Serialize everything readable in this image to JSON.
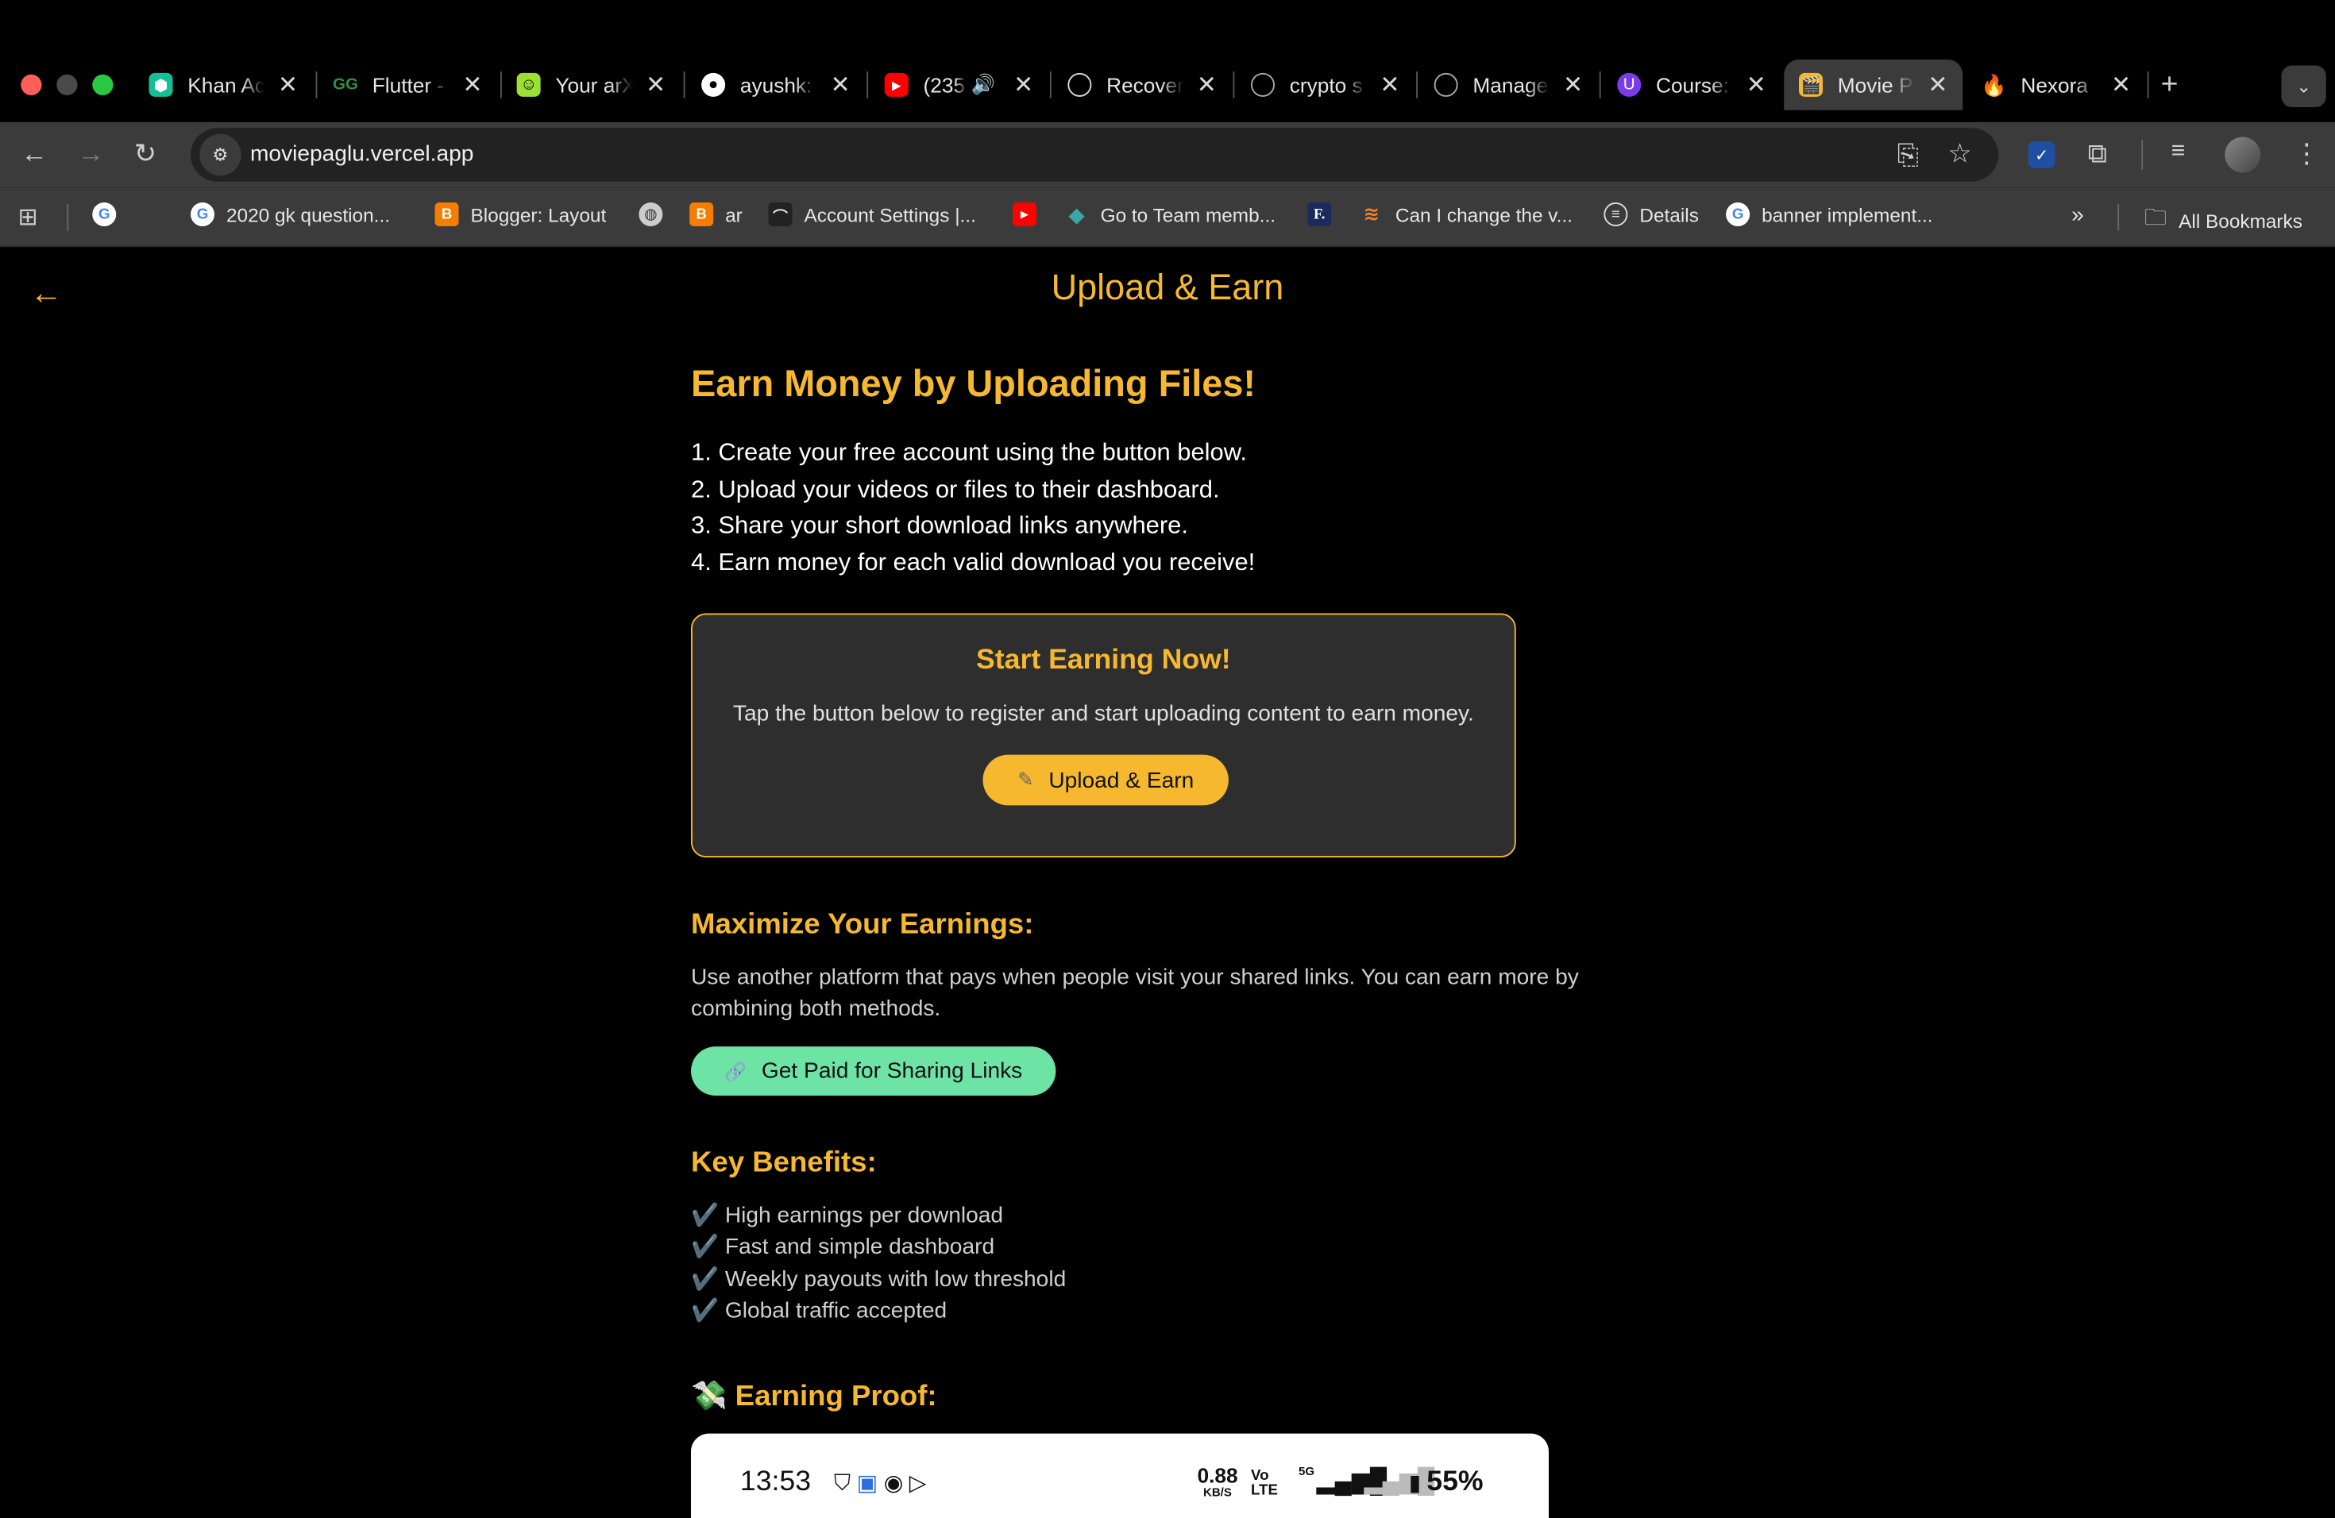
{
  "browser": {
    "tabs": [
      {
        "title": "Khan Ac",
        "icon": "khan-academy-icon",
        "color": "#14bf96"
      },
      {
        "title": "Flutter -",
        "icon": "geeksforgeeks-icon",
        "color": "#2f8d46"
      },
      {
        "title": "Your arX",
        "icon": "smiley-icon",
        "color": "#9be032"
      },
      {
        "title": "ayushk:",
        "icon": "github-icon",
        "color": "#ffffff"
      },
      {
        "title": "(235",
        "icon": "youtube-icon",
        "color": "#ff0000"
      },
      {
        "title": "Recover",
        "icon": "openai-icon",
        "color": "#e0e0e0"
      },
      {
        "title": "crypto s",
        "icon": "openai-icon",
        "color": "#e0e0e0"
      },
      {
        "title": "Manage",
        "icon": "openai-icon",
        "color": "#e0e0e0"
      },
      {
        "title": "Course:",
        "icon": "course-icon",
        "color": "#7c3aed"
      },
      {
        "title": "Movie P",
        "icon": "clapperboard-icon",
        "color": "#f5b82e"
      },
      {
        "title": "Nexora",
        "icon": "fire-icon",
        "color": "#ff6b2c"
      }
    ],
    "url": "moviepaglu.vercel.app",
    "bookmarks": [
      {
        "label": "",
        "icon": "google-icon"
      },
      {
        "label": "2020 gk question...",
        "icon": "google-icon"
      },
      {
        "label": "Blogger: Layout",
        "icon": "blogger-icon"
      },
      {
        "label": "",
        "icon": "globe-icon"
      },
      {
        "label": "ar",
        "icon": "blogger-icon"
      },
      {
        "label": "Account Settings |...",
        "icon": "account-icon"
      },
      {
        "label": "",
        "icon": "youtube-icon"
      },
      {
        "label": "Go to Team memb...",
        "icon": "diamond-icon"
      },
      {
        "label": "",
        "icon": "f-logo-icon"
      },
      {
        "label": "Can I change the v...",
        "icon": "stackoverflow-icon"
      },
      {
        "label": "Details",
        "icon": "details-icon"
      },
      {
        "label": "banner implement...",
        "icon": "google-icon"
      }
    ],
    "all_bookmarks": "All Bookmarks",
    "more_bookmarks": "»"
  },
  "page": {
    "title": "Upload & Earn",
    "heading": "Earn Money by Uploading Files!",
    "steps": [
      "1. Create your free account using the button below.",
      "2. Upload your videos or files to their dashboard.",
      "3. Share your short download links anywhere.",
      "4. Earn money for each valid download you receive!"
    ],
    "card": {
      "title": "Start Earning Now!",
      "text": "Tap the button below to register and start uploading content to earn money.",
      "button": "Upload & Earn",
      "button_icon": "pencil-icon"
    },
    "maximize": {
      "heading": "Maximize Your Earnings:",
      "text": "Use another platform that pays when people visit your shared links. You can earn more by combining both methods.",
      "button": "Get Paid for Sharing Links",
      "button_icon": "link-icon"
    },
    "benefits": {
      "heading": "Key Benefits:",
      "items": [
        "✔️ High earnings per download",
        "✔️ Fast and simple dashboard",
        "✔️ Weekly payouts with low threshold",
        "✔️ Global traffic accepted"
      ]
    },
    "proof": {
      "heading": "💸 Earning Proof:",
      "time": "13:53",
      "speed_value": "0.88",
      "speed_unit": "KB/S",
      "network": "Vo LTE",
      "signal": "5G",
      "battery": "55%"
    }
  },
  "colors": {
    "accent": "#f5b82e",
    "green": "#6ee3a6",
    "card_bg": "#2e2e2e",
    "chrome_bg": "#3b3b3b"
  }
}
